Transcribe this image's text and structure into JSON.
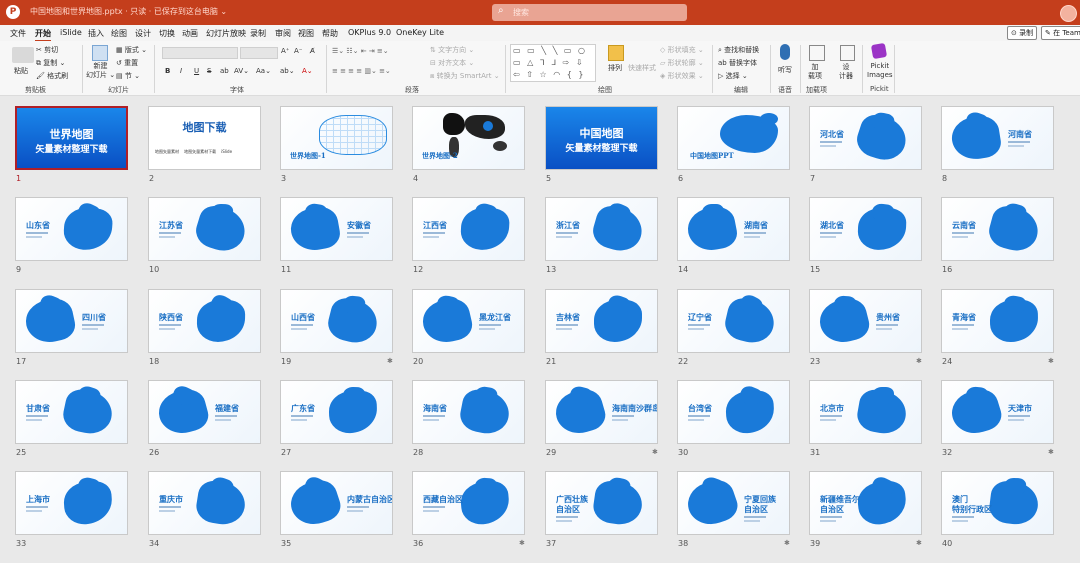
{
  "titlebar": {
    "doc_title": "中国地图和世界地图.pptx · 只读 · 已保存到这台电脑 ⌄",
    "search_placeholder": "搜索"
  },
  "menu": {
    "items": [
      "文件",
      "开始",
      "iSlide",
      "插入",
      "绘图",
      "设计",
      "切换",
      "动画",
      "幻灯片放映",
      "录制",
      "审阅",
      "视图",
      "帮助",
      "OKPlus 9.0",
      "OneKey Lite"
    ],
    "record_label": "⊙ 录制",
    "share_label": "✎ 在 Teams"
  },
  "ribbon": {
    "clipboard": {
      "paste": "粘贴",
      "cut": "✂ 剪切",
      "copy": "⧉ 复制 ⌄",
      "format_painter": "🖌 格式刷",
      "group": "剪贴板"
    },
    "slides": {
      "new_slide": "新建\n幻灯片 ⌄",
      "layout": "▦ 版式 ⌄",
      "reset": "↺ 重置",
      "section": "▤ 节 ⌄",
      "group": "幻灯片"
    },
    "font": {
      "grow": "A⁺",
      "shrink": "A⁻",
      "clear": "A̸",
      "bold": "B",
      "italic": "I",
      "underline": "U",
      "strike": "S",
      "shadow": "ab",
      "spacing": "AV⌄",
      "case": "Aa⌄",
      "highlight": "ab⌄",
      "color": "A⌄",
      "group": "字体"
    },
    "paragraph": {
      "text_direction": "⇅ 文字方向 ⌄",
      "align_text": "⊟ 对齐文本 ⌄",
      "smartart": "⧈ 转换为 SmartArt ⌄",
      "group": "段落"
    },
    "drawing": {
      "shapes": "▭ ▭ ╲ ╲ ▭ ○\n▭ △ ᒣ ᒧ ⇨ ⇩\n⇦ ⇧ ☆ ◠ { }",
      "arrange": "排列",
      "quick_styles": "快速样式",
      "fill": "◇ 形状填充 ⌄",
      "outline": "▱ 形状轮廓 ⌄",
      "effects": "◈ 形状效果 ⌄",
      "group": "绘图"
    },
    "editing": {
      "find": "⌕ 查找和替换",
      "replace": "ab 替换字体",
      "select": "▷ 选择 ⌄",
      "group": "编辑"
    },
    "voice": {
      "dictate": "听写",
      "group": "语音"
    },
    "addins": {
      "addins": "加\n载项",
      "group": "加载项"
    },
    "design": {
      "designer": "设\n计器"
    },
    "pickit": {
      "images": "Pickit\nImages",
      "group": "Pickit"
    }
  },
  "slides": [
    {
      "num": "1",
      "type": "title",
      "title": "世界地图",
      "subtitle": "矢量素材整理下载",
      "selected": true
    },
    {
      "num": "2",
      "type": "download",
      "title": "地图下载",
      "subtitle": "地图矢量素材    地图矢量素材下载    iSlide"
    },
    {
      "num": "3",
      "type": "worldmap",
      "label": "世界地图-1"
    },
    {
      "num": "4",
      "type": "worldmap2",
      "label": "世界地图-2"
    },
    {
      "num": "5",
      "type": "title",
      "title": "中国地图",
      "subtitle": "矢量素材整理下载"
    },
    {
      "num": "6",
      "type": "chinamap",
      "label": "中国地图PPT"
    },
    {
      "num": "7",
      "type": "province",
      "label": "河北省"
    },
    {
      "num": "8",
      "type": "province",
      "label": "河南省"
    },
    {
      "num": "9",
      "type": "province",
      "label": "山东省"
    },
    {
      "num": "10",
      "type": "province",
      "label": "江苏省"
    },
    {
      "num": "11",
      "type": "province",
      "label": "安徽省"
    },
    {
      "num": "12",
      "type": "province",
      "label": "江西省"
    },
    {
      "num": "13",
      "type": "province",
      "label": "浙江省"
    },
    {
      "num": "14",
      "type": "province",
      "label": "湖南省"
    },
    {
      "num": "15",
      "type": "province",
      "label": "湖北省"
    },
    {
      "num": "16",
      "type": "province",
      "label": "云南省"
    },
    {
      "num": "17",
      "type": "province",
      "label": "四川省"
    },
    {
      "num": "18",
      "type": "province",
      "label": "陕西省"
    },
    {
      "num": "19",
      "type": "province",
      "label": "山西省",
      "star": true
    },
    {
      "num": "20",
      "type": "province",
      "label": "黑龙江省"
    },
    {
      "num": "21",
      "type": "province",
      "label": "吉林省"
    },
    {
      "num": "22",
      "type": "province",
      "label": "辽宁省"
    },
    {
      "num": "23",
      "type": "province",
      "label": "贵州省",
      "star": true
    },
    {
      "num": "24",
      "type": "province",
      "label": "青海省",
      "star": true
    },
    {
      "num": "25",
      "type": "province",
      "label": "甘肃省"
    },
    {
      "num": "26",
      "type": "province",
      "label": "福建省"
    },
    {
      "num": "27",
      "type": "province",
      "label": "广东省"
    },
    {
      "num": "28",
      "type": "province",
      "label": "海南省"
    },
    {
      "num": "29",
      "type": "province",
      "label": "海南南沙群岛",
      "star": true
    },
    {
      "num": "30",
      "type": "province",
      "label": "台湾省"
    },
    {
      "num": "31",
      "type": "province",
      "label": "北京市"
    },
    {
      "num": "32",
      "type": "province",
      "label": "天津市",
      "star": true
    },
    {
      "num": "33",
      "type": "province",
      "label": "上海市"
    },
    {
      "num": "34",
      "type": "province",
      "label": "重庆市"
    },
    {
      "num": "35",
      "type": "province",
      "label": "内蒙古自治区"
    },
    {
      "num": "36",
      "type": "province",
      "label": "西藏自治区",
      "star": true
    },
    {
      "num": "37",
      "type": "province",
      "label": "广西壮族\n自治区"
    },
    {
      "num": "38",
      "type": "province",
      "label": "宁夏回族\n自治区",
      "star": true
    },
    {
      "num": "39",
      "type": "province",
      "label": "新疆维吾尔\n自治区",
      "star": true
    },
    {
      "num": "40",
      "type": "province",
      "label": "澳门\n特别行政区"
    }
  ],
  "colors": {
    "title_bar": "#c43e1c",
    "map_blue": "#1a7ad9",
    "selected_border": "#b01f27"
  }
}
